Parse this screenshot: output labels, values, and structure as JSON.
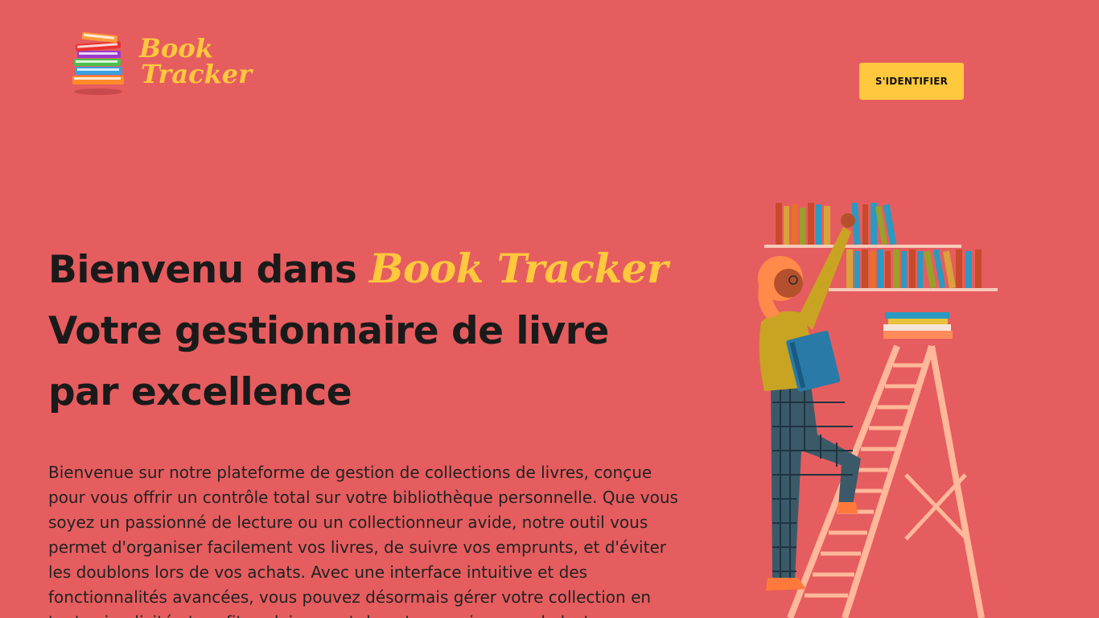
{
  "header": {
    "logo_line1": "Book",
    "logo_line2": "Tracker",
    "signin_label": "S'IDENTIFIER"
  },
  "hero": {
    "title_prefix": "Bienvenu dans ",
    "title_brand": "Book Tracker",
    "title_line2": "Votre gestionnaire de livre",
    "title_line3": "par excellence",
    "description": "Bienvenue sur notre plateforme de gestion de collections de livres, conçue pour vous offrir un contrôle total sur votre bibliothèque personnelle. Que vous soyez un passionné de lecture ou un collectionneur avide, notre outil vous permet d'organiser facilement vos livres, de suivre vos emprunts, et d'éviter les doublons lors de vos achats. Avec une interface intuitive et des fonctionnalités avancées, vous pouvez désormais gérer votre collection en toute simplicité et profiter pleinement de votre passion pour la lecture."
  },
  "colors": {
    "background": "#e65d5f",
    "accent": "#ffc83d",
    "text": "#1a1a1a"
  },
  "icons": {
    "logo": "book-stack-icon",
    "illustration": "woman-on-ladder-bookshelf-illustration"
  }
}
